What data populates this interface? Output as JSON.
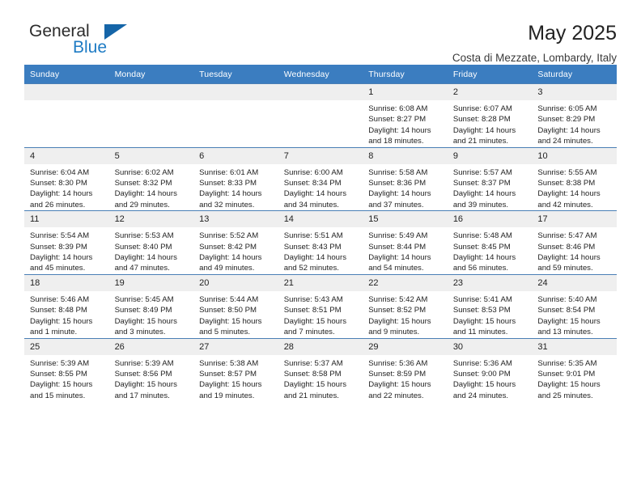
{
  "logo": {
    "word_top": "General",
    "word_bottom": "Blue",
    "triangle_color": "#1565a8",
    "blue_color": "#1e7bc4"
  },
  "header": {
    "title": "May 2025",
    "subtitle": "Costa di Mezzate, Lombardy, Italy"
  },
  "theme": {
    "header_blue": "#3b7dc0",
    "daynum_gray": "#efefef",
    "grid_line": "#4a7fb5"
  },
  "calendar": {
    "weekday_headers": [
      "Sunday",
      "Monday",
      "Tuesday",
      "Wednesday",
      "Thursday",
      "Friday",
      "Saturday"
    ],
    "weeks": [
      [
        {
          "day": "",
          "lines": []
        },
        {
          "day": "",
          "lines": []
        },
        {
          "day": "",
          "lines": []
        },
        {
          "day": "",
          "lines": []
        },
        {
          "day": "1",
          "lines": [
            "Sunrise: 6:08 AM",
            "Sunset: 8:27 PM",
            "Daylight: 14 hours",
            "and 18 minutes."
          ]
        },
        {
          "day": "2",
          "lines": [
            "Sunrise: 6:07 AM",
            "Sunset: 8:28 PM",
            "Daylight: 14 hours",
            "and 21 minutes."
          ]
        },
        {
          "day": "3",
          "lines": [
            "Sunrise: 6:05 AM",
            "Sunset: 8:29 PM",
            "Daylight: 14 hours",
            "and 24 minutes."
          ]
        }
      ],
      [
        {
          "day": "4",
          "lines": [
            "Sunrise: 6:04 AM",
            "Sunset: 8:30 PM",
            "Daylight: 14 hours",
            "and 26 minutes."
          ]
        },
        {
          "day": "5",
          "lines": [
            "Sunrise: 6:02 AM",
            "Sunset: 8:32 PM",
            "Daylight: 14 hours",
            "and 29 minutes."
          ]
        },
        {
          "day": "6",
          "lines": [
            "Sunrise: 6:01 AM",
            "Sunset: 8:33 PM",
            "Daylight: 14 hours",
            "and 32 minutes."
          ]
        },
        {
          "day": "7",
          "lines": [
            "Sunrise: 6:00 AM",
            "Sunset: 8:34 PM",
            "Daylight: 14 hours",
            "and 34 minutes."
          ]
        },
        {
          "day": "8",
          "lines": [
            "Sunrise: 5:58 AM",
            "Sunset: 8:36 PM",
            "Daylight: 14 hours",
            "and 37 minutes."
          ]
        },
        {
          "day": "9",
          "lines": [
            "Sunrise: 5:57 AM",
            "Sunset: 8:37 PM",
            "Daylight: 14 hours",
            "and 39 minutes."
          ]
        },
        {
          "day": "10",
          "lines": [
            "Sunrise: 5:55 AM",
            "Sunset: 8:38 PM",
            "Daylight: 14 hours",
            "and 42 minutes."
          ]
        }
      ],
      [
        {
          "day": "11",
          "lines": [
            "Sunrise: 5:54 AM",
            "Sunset: 8:39 PM",
            "Daylight: 14 hours",
            "and 45 minutes."
          ]
        },
        {
          "day": "12",
          "lines": [
            "Sunrise: 5:53 AM",
            "Sunset: 8:40 PM",
            "Daylight: 14 hours",
            "and 47 minutes."
          ]
        },
        {
          "day": "13",
          "lines": [
            "Sunrise: 5:52 AM",
            "Sunset: 8:42 PM",
            "Daylight: 14 hours",
            "and 49 minutes."
          ]
        },
        {
          "day": "14",
          "lines": [
            "Sunrise: 5:51 AM",
            "Sunset: 8:43 PM",
            "Daylight: 14 hours",
            "and 52 minutes."
          ]
        },
        {
          "day": "15",
          "lines": [
            "Sunrise: 5:49 AM",
            "Sunset: 8:44 PM",
            "Daylight: 14 hours",
            "and 54 minutes."
          ]
        },
        {
          "day": "16",
          "lines": [
            "Sunrise: 5:48 AM",
            "Sunset: 8:45 PM",
            "Daylight: 14 hours",
            "and 56 minutes."
          ]
        },
        {
          "day": "17",
          "lines": [
            "Sunrise: 5:47 AM",
            "Sunset: 8:46 PM",
            "Daylight: 14 hours",
            "and 59 minutes."
          ]
        }
      ],
      [
        {
          "day": "18",
          "lines": [
            "Sunrise: 5:46 AM",
            "Sunset: 8:48 PM",
            "Daylight: 15 hours",
            "and 1 minute."
          ]
        },
        {
          "day": "19",
          "lines": [
            "Sunrise: 5:45 AM",
            "Sunset: 8:49 PM",
            "Daylight: 15 hours",
            "and 3 minutes."
          ]
        },
        {
          "day": "20",
          "lines": [
            "Sunrise: 5:44 AM",
            "Sunset: 8:50 PM",
            "Daylight: 15 hours",
            "and 5 minutes."
          ]
        },
        {
          "day": "21",
          "lines": [
            "Sunrise: 5:43 AM",
            "Sunset: 8:51 PM",
            "Daylight: 15 hours",
            "and 7 minutes."
          ]
        },
        {
          "day": "22",
          "lines": [
            "Sunrise: 5:42 AM",
            "Sunset: 8:52 PM",
            "Daylight: 15 hours",
            "and 9 minutes."
          ]
        },
        {
          "day": "23",
          "lines": [
            "Sunrise: 5:41 AM",
            "Sunset: 8:53 PM",
            "Daylight: 15 hours",
            "and 11 minutes."
          ]
        },
        {
          "day": "24",
          "lines": [
            "Sunrise: 5:40 AM",
            "Sunset: 8:54 PM",
            "Daylight: 15 hours",
            "and 13 minutes."
          ]
        }
      ],
      [
        {
          "day": "25",
          "lines": [
            "Sunrise: 5:39 AM",
            "Sunset: 8:55 PM",
            "Daylight: 15 hours",
            "and 15 minutes."
          ]
        },
        {
          "day": "26",
          "lines": [
            "Sunrise: 5:39 AM",
            "Sunset: 8:56 PM",
            "Daylight: 15 hours",
            "and 17 minutes."
          ]
        },
        {
          "day": "27",
          "lines": [
            "Sunrise: 5:38 AM",
            "Sunset: 8:57 PM",
            "Daylight: 15 hours",
            "and 19 minutes."
          ]
        },
        {
          "day": "28",
          "lines": [
            "Sunrise: 5:37 AM",
            "Sunset: 8:58 PM",
            "Daylight: 15 hours",
            "and 21 minutes."
          ]
        },
        {
          "day": "29",
          "lines": [
            "Sunrise: 5:36 AM",
            "Sunset: 8:59 PM",
            "Daylight: 15 hours",
            "and 22 minutes."
          ]
        },
        {
          "day": "30",
          "lines": [
            "Sunrise: 5:36 AM",
            "Sunset: 9:00 PM",
            "Daylight: 15 hours",
            "and 24 minutes."
          ]
        },
        {
          "day": "31",
          "lines": [
            "Sunrise: 5:35 AM",
            "Sunset: 9:01 PM",
            "Daylight: 15 hours",
            "and 25 minutes."
          ]
        }
      ]
    ]
  }
}
